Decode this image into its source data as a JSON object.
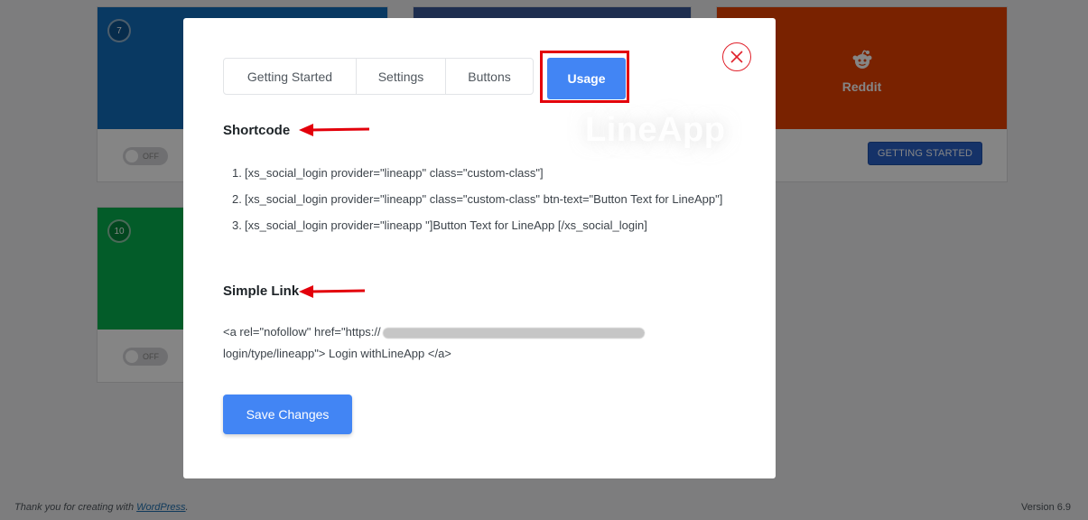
{
  "background": {
    "cards": [
      {
        "number": "7",
        "color": "#136ebc",
        "toggle": "OFF"
      },
      {
        "number": "",
        "color": "#3b5998"
      },
      {
        "label": "Reddit",
        "color": "#ff4500",
        "button": "GETTING STARTED"
      },
      {
        "number": "10",
        "color": "#06b04f",
        "toggle": "OFF"
      }
    ]
  },
  "modal": {
    "tabs": [
      {
        "label": "Getting Started"
      },
      {
        "label": "Settings"
      },
      {
        "label": "Buttons"
      },
      {
        "label": "Usage",
        "active": true
      }
    ],
    "watermark": "LineApp",
    "shortcode": {
      "title": "Shortcode",
      "items": [
        {
          "n": "1.",
          "text": "[xs_social_login provider=\"lineapp\" class=\"custom-class\"]"
        },
        {
          "n": "2.",
          "text": "[xs_social_login provider=\"lineapp\" class=\"custom-class\" btn-text=\"Button Text for LineApp\"]"
        },
        {
          "n": "3.",
          "text": "[xs_social_login provider=\"lineapp \"]Button Text for LineApp [/xs_social_login]"
        }
      ]
    },
    "simple_link": {
      "title": "Simple Link",
      "prefix": "<a rel=\"nofollow\" href=\"https://",
      "suffix": "-login/type/lineapp\"> Login withLineApp </a>"
    },
    "save_label": "Save Changes"
  },
  "footer": {
    "thanks": "Thank you for creating with ",
    "link": "WordPress",
    "period": ".",
    "version": "Version 6.9"
  },
  "colors": {
    "accent": "#4285f4",
    "highlight": "#e3000b",
    "close": "#e0202a"
  }
}
